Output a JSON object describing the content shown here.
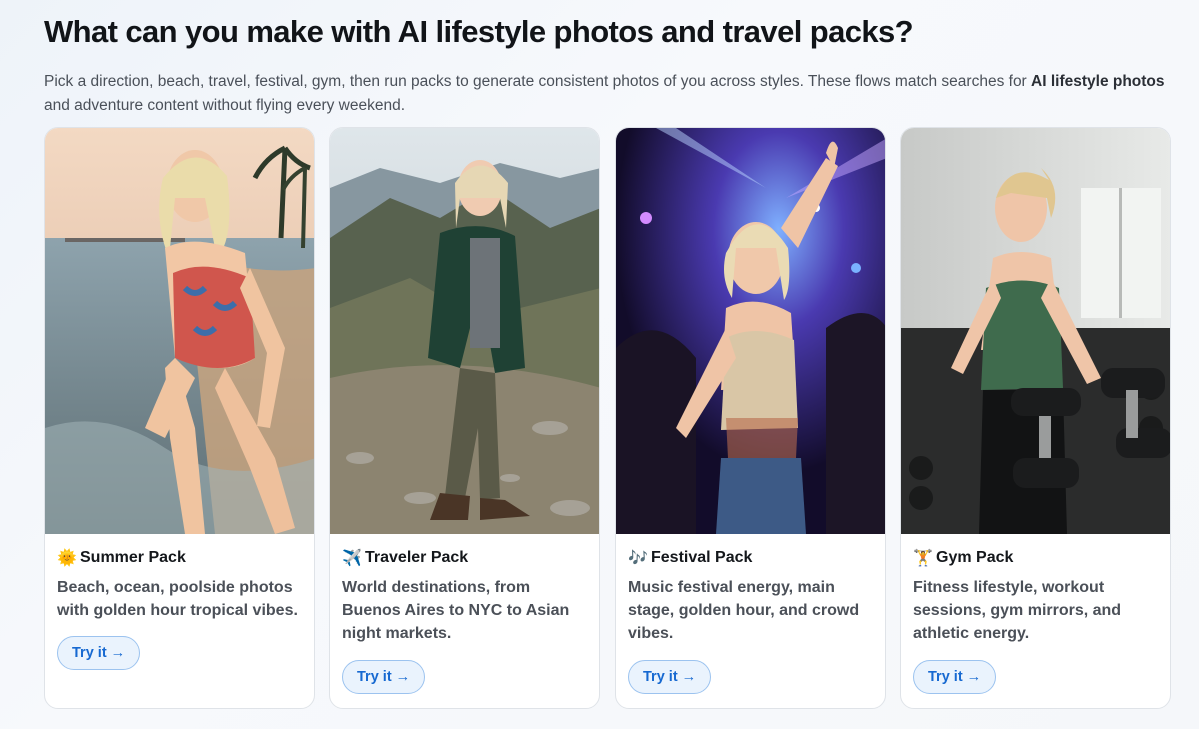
{
  "header": {
    "title": "What can you make with AI lifestyle photos and travel packs?",
    "intro_part1": "Pick a direction, beach, travel, festival, gym, then run packs to generate consistent photos of you across styles. These flows match searches for ",
    "intro_bold": "AI lifestyle photos",
    "intro_part2": " and adventure content without flying every weekend."
  },
  "cards": [
    {
      "icon": "sun-face-icon",
      "emoji": "🌞",
      "name": "Summer Pack",
      "description": "Beach, ocean, poolside photos with golden hour tropical vibes.",
      "cta": "Try it →",
      "photo": "woman-laughing-on-beach-in-swimsuit"
    },
    {
      "icon": "airplane-icon",
      "emoji": "✈️",
      "name": "Traveler Pack",
      "description": "World destinations, from Buenos Aires to NYC to Asian night markets.",
      "cta": "Try it →",
      "photo": "woman-hiking-on-mountain-ridge"
    },
    {
      "icon": "music-notes-icon",
      "emoji": "🎶",
      "name": "Festival Pack",
      "description": "Music festival energy, main stage, golden hour, and crowd vibes.",
      "cta": "Try it →",
      "photo": "woman-dancing-at-music-festival"
    },
    {
      "icon": "weightlifter-icon",
      "emoji": "🏋️",
      "name": "Gym Pack",
      "description": "Fitness lifestyle, workout sessions, gym mirrors, and athletic energy.",
      "cta": "Try it →",
      "photo": "woman-lifting-dumbbells-in-gym"
    }
  ]
}
